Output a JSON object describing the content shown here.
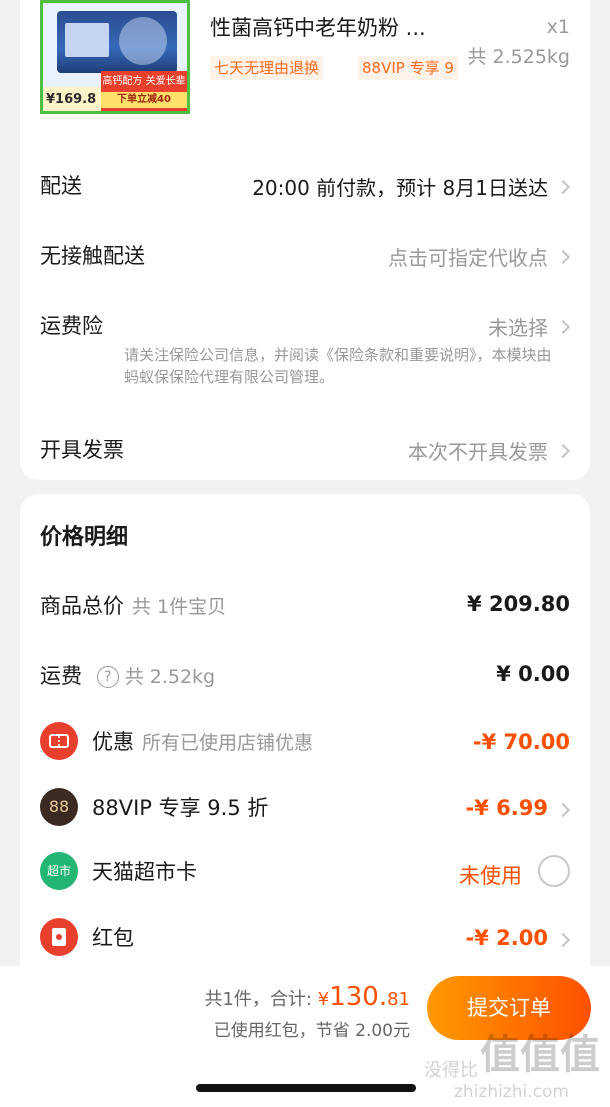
{
  "product": {
    "title": "性菌高钙中老年奶粉 ...",
    "qty": "x1",
    "weight": "共 2.525kg",
    "tags": [
      "七天无理由退换",
      "88VIP 专享 9"
    ],
    "image_price": "¥169.8",
    "image_promo_line1": "高钙配方 关爱长辈",
    "image_promo_line2": "下单立减40"
  },
  "rows": {
    "delivery": {
      "label": "配送",
      "value": "20:00 前付款，预计 8月1日送达"
    },
    "contactless": {
      "label": "无接触配送",
      "value": "点击可指定代收点"
    },
    "insurance": {
      "label": "运费险",
      "value": "未选择",
      "note": "请关注保险公司信息，并阅读《保险条款和重要说明》，本模块由蚂蚁保保险代理有限公司管理。"
    },
    "invoice": {
      "label": "开具发票",
      "value": "本次不开具发票"
    }
  },
  "price": {
    "title": "价格明细",
    "goods": {
      "label": "商品总价",
      "sub": "共 1件宝贝",
      "amount": "¥ 209.80"
    },
    "shipping": {
      "label": "运费",
      "sub": "共 2.52kg",
      "amount": "¥ 0.00"
    },
    "discount": {
      "label": "优惠",
      "sub": "所有已使用店铺优惠",
      "amount": "-¥ 70.00",
      "icon_text": ""
    },
    "vip": {
      "label": "88VIP 专享 9.5 折",
      "amount": "-¥ 6.99",
      "icon_text": "88"
    },
    "tmall_card": {
      "label": "天猫超市卡",
      "value": "未使用",
      "icon_text": "超市"
    },
    "red_packet": {
      "label": "红包",
      "amount": "-¥ 2.00"
    }
  },
  "footer": {
    "count": "共1件，",
    "total_label": "合计:",
    "currency": "¥",
    "total_int": "130.",
    "total_dec": "81",
    "saved": "已使用红包，节省 2.00元",
    "submit": "提交订单"
  },
  "watermark": {
    "cn": "没得比",
    "site": "zhizhizhi.com",
    "logo": "值值值"
  },
  "colors": {
    "accent": "#ff5000",
    "discount_red": "#e8402d",
    "tag_bg": "#fff3e9"
  }
}
